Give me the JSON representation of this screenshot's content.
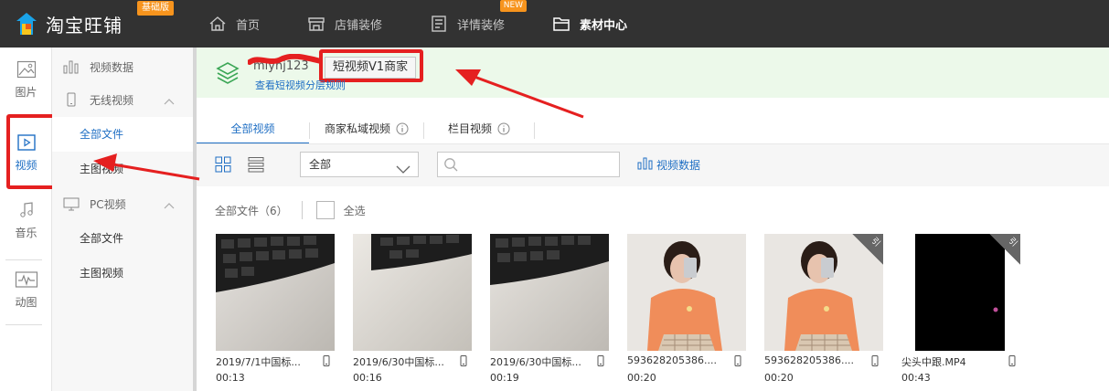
{
  "app": {
    "logo_text": "淘宝旺铺",
    "edition_badge": "基础版"
  },
  "top_nav": [
    {
      "label": "首页",
      "icon": "home-icon"
    },
    {
      "label": "店铺装修",
      "icon": "shop-icon"
    },
    {
      "label": "详情装修",
      "icon": "detail-icon",
      "badge": "NEW"
    },
    {
      "label": "素材中心",
      "icon": "folder-icon",
      "active": true
    }
  ],
  "left_rail": [
    {
      "label": "图片",
      "icon": "image-icon"
    },
    {
      "label": "视频",
      "icon": "video-icon",
      "active": true
    },
    {
      "label": "音乐",
      "icon": "music-icon"
    },
    {
      "label": "动图",
      "icon": "gif-icon"
    }
  ],
  "sub_nav": {
    "video_data": "视频数据",
    "wireless": {
      "label": "无线视频",
      "items": [
        "全部文件",
        "主图视频"
      ]
    },
    "pc": {
      "label": "PC视频",
      "items": [
        "全部文件",
        "主图视频"
      ]
    }
  },
  "notice": {
    "username": "mlyhj123",
    "tier_label": "短视频V1商家",
    "link_text": "查看短视频分层规则"
  },
  "tabs": [
    {
      "label": "全部视频",
      "active": true
    },
    {
      "label": "商家私域视频",
      "info": true
    },
    {
      "label": "栏目视频",
      "info": true
    }
  ],
  "toolbar": {
    "filter_selected": "全部",
    "search_placeholder": "",
    "data_link": "视频数据"
  },
  "files": {
    "header": "全部文件（6）",
    "select_all": "全选",
    "items": [
      {
        "name": "2019/7/1中国标...",
        "duration": "00:13",
        "thumb": "keyboard-1"
      },
      {
        "name": "2019/6/30中国标...",
        "duration": "00:16",
        "thumb": "keyboard-2"
      },
      {
        "name": "2019/6/30中国标...",
        "duration": "00:19",
        "thumb": "keyboard-3"
      },
      {
        "name": "593628205386....",
        "duration": "00:20",
        "thumb": "girl-1"
      },
      {
        "name": "593628205386....",
        "duration": "00:20",
        "thumb": "girl-2",
        "corner": "引"
      },
      {
        "name": "尖头中跟.MP4",
        "duration": "00:43",
        "thumb": "black",
        "corner": "引"
      }
    ]
  },
  "colors": {
    "topbar_bg": "#323232",
    "accent_blue": "#1f6fc4",
    "annotation_red": "#e52020",
    "notice_bg": "#ecf9ea"
  }
}
